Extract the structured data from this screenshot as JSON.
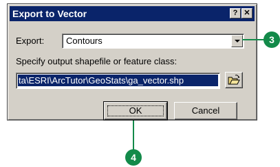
{
  "dialog": {
    "title": "Export to Vector",
    "help_glyph": "?",
    "close_glyph": "✕",
    "export_label": "Export:",
    "export_value": "Contours",
    "specify_label": "Specify output shapefile or feature class:",
    "path_value": "ta\\ESRI\\ArcTutor\\GeoStats\\ga_vector.shp",
    "ok_label": "OK",
    "cancel_label": "Cancel"
  },
  "callouts": {
    "step3": "3",
    "step4": "4"
  },
  "colors": {
    "title_bar": "#0a246a",
    "face": "#d4d0c8",
    "callout": "#138a4a"
  }
}
